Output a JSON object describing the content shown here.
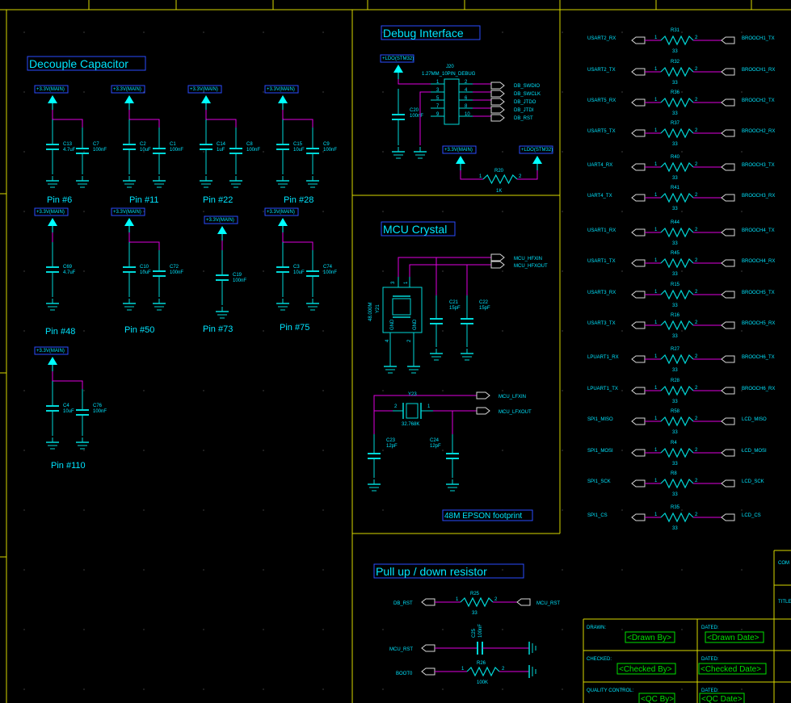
{
  "colors": {
    "background": "#000000",
    "frame": "#d8d800",
    "wire": "#e000e0",
    "component": "#00d8d8",
    "power": "#00ffff",
    "label_box": "#2a4dff",
    "text": "#00e5ff",
    "titleblock_text": "#00e000",
    "net_label_box": "#d8d8d8"
  },
  "sections": {
    "decouple": {
      "title": "Decouple Capacitor"
    },
    "debug": {
      "title": "Debug Interface"
    },
    "crystal": {
      "title": "MCU Crystal",
      "footnote": "48M EPSON footprint"
    },
    "pull": {
      "title": "Pull up / down resistor"
    }
  },
  "decouple": {
    "groups": [
      {
        "power": "+3.3V(MAIN)",
        "caps": [
          {
            "ref": "C13",
            "val": "4.7uF"
          },
          {
            "ref": "C7",
            "val": "100nF"
          }
        ],
        "pin": "Pin #6"
      },
      {
        "power": "+3.3V(MAIN)",
        "caps": [
          {
            "ref": "C2",
            "val": "10uF"
          },
          {
            "ref": "C1",
            "val": "100nF"
          }
        ],
        "pin": "Pin #11"
      },
      {
        "power": "+3.3V(MAIN)",
        "caps": [
          {
            "ref": "C14",
            "val": "1uF"
          },
          {
            "ref": "C8",
            "val": "100nF"
          }
        ],
        "pin": "Pin #22"
      },
      {
        "power": "+3.3V(MAIN)",
        "caps": [
          {
            "ref": "C15",
            "val": "10uF"
          },
          {
            "ref": "C9",
            "val": "100nF"
          }
        ],
        "pin": "Pin #28"
      },
      {
        "power": "+3.3V(MAIN)",
        "caps": [
          {
            "ref": "C69",
            "val": "4.7uF"
          }
        ],
        "pin": "Pin #48"
      },
      {
        "power": "+3.3V(MAIN)",
        "caps": [
          {
            "ref": "C10",
            "val": "10uF"
          },
          {
            "ref": "C72",
            "val": "100nF"
          }
        ],
        "pin": "Pin #50"
      },
      {
        "power": "+3.3V(MAIN)",
        "caps": [
          {
            "ref": "C19",
            "val": "100nF"
          }
        ],
        "pin": "Pin #73"
      },
      {
        "power": "+3.3V(MAIN)",
        "caps": [
          {
            "ref": "C3",
            "val": "10uF"
          },
          {
            "ref": "C74",
            "val": "100nF"
          }
        ],
        "pin": "Pin #75"
      },
      {
        "power": "+3.3V(MAIN)",
        "caps": [
          {
            "ref": "C4",
            "val": "10uF"
          },
          {
            "ref": "C76",
            "val": "100nF"
          }
        ],
        "pin": "Pin #110"
      }
    ]
  },
  "debug": {
    "power_ldo": "+LDO(STM32)",
    "header_ref": "J20",
    "header_name": "1.27MM_10PIN_DEBUG",
    "cap_ref": "C20",
    "cap_val": "100nF",
    "left_pins": [
      "1",
      "3",
      "5",
      "7",
      "9"
    ],
    "right_pins": [
      "2",
      "4",
      "6",
      "8",
      "10"
    ],
    "nets": [
      "DB_SWDIO",
      "DB_SWCLK",
      "DB_JTDO",
      "DB_JTDI",
      "DB_RST"
    ],
    "pullup_power_left": "+3.3V(MAIN)",
    "pullup_power_right": "+LDO(STM32)",
    "res_ref": "R20",
    "res_val": "1K",
    "res_pin1": "1",
    "res_pin2": "2"
  },
  "crystal": {
    "hf_nets": [
      "MCU_HFXIN",
      "MCU_HFXOUT"
    ],
    "y21_ref": "Y21",
    "y21_val": "48.000M",
    "y21_pins": [
      "3",
      "1",
      "4",
      "2"
    ],
    "gnd": "GND",
    "c21_ref": "C21",
    "c21_val": "15pF",
    "c22_ref": "C22",
    "c22_val": "15pF",
    "lf_nets": [
      "MCU_LFXIN",
      "MCU_LFXOUT"
    ],
    "y23_ref": "Y23",
    "y23_val": "32.768K",
    "y23_pin_left": "2",
    "y23_pin_right": "1",
    "c23_ref": "C23",
    "c23_val": "12pF",
    "c24_ref": "C24",
    "c24_val": "12pF"
  },
  "resistors": [
    {
      "left": "USART2_RX",
      "ref": "R31",
      "val": "33",
      "right": "BROOCH1_TX"
    },
    {
      "left": "USART2_TX",
      "ref": "R32",
      "val": "33",
      "right": "BROOCH1_RX"
    },
    {
      "left": "USART5_RX",
      "ref": "R36",
      "val": "33",
      "right": "BROOCH2_TX"
    },
    {
      "left": "USART5_TX",
      "ref": "R37",
      "val": "33",
      "right": "BROOCH2_RX"
    },
    {
      "left": "UART4_RX",
      "ref": "R40",
      "val": "33",
      "right": "BROOCH3_TX"
    },
    {
      "left": "UART4_TX",
      "ref": "R41",
      "val": "33",
      "right": "BROOCH3_RX"
    },
    {
      "left": "USART1_RX",
      "ref": "R44",
      "val": "33",
      "right": "BROOCH4_TX"
    },
    {
      "left": "USART1_TX",
      "ref": "R45",
      "val": "33",
      "right": "BROOCH4_RX"
    },
    {
      "left": "USART3_RX",
      "ref": "R15",
      "val": "33",
      "right": "BROOCH5_TX"
    },
    {
      "left": "USART3_TX",
      "ref": "R16",
      "val": "33",
      "right": "BROOCH5_RX"
    },
    {
      "left": "LPUART1_RX",
      "ref": "R27",
      "val": "33",
      "right": "BROOCH6_TX"
    },
    {
      "left": "LPUART1_TX",
      "ref": "R28",
      "val": "33",
      "right": "BROOCH6_RX"
    },
    {
      "left": "SPI1_MISO",
      "ref": "R58",
      "val": "33",
      "right": "LCD_MISO"
    },
    {
      "left": "SPI1_MOSI",
      "ref": "R4",
      "val": "33",
      "right": "LCD_MOSI"
    },
    {
      "left": "SPI1_SCK",
      "ref": "R8",
      "val": "33",
      "right": "LCD_SCK"
    },
    {
      "left": "SPI1_CS",
      "ref": "R35",
      "val": "33",
      "right": "LCD_CS"
    }
  ],
  "res_pin1": "1",
  "res_pin2": "2",
  "pull": {
    "r25": {
      "left": "DB_RST",
      "ref": "R25",
      "val": "33",
      "right": "MCU_RST"
    },
    "c25": {
      "left": "MCU_RST",
      "ref": "C25",
      "val": "100nF"
    },
    "r26": {
      "left": "BOOT0",
      "ref": "R26",
      "val": "100K"
    }
  },
  "titleblock": {
    "drawn_label": "DRAWN:",
    "drawn_value": "<Drawn By>",
    "dated_label": "DATED:",
    "drawn_date": "<Drawn Date>",
    "checked_label": "CHECKED:",
    "checked_value": "<Checked By>",
    "checked_date": "<Checked Date>",
    "qc_label": "QUALITY CONTROL:",
    "qc_value": "<QC By>",
    "qc_date": "<QC Date>",
    "side_labels": [
      "COM",
      "TITLE"
    ]
  }
}
